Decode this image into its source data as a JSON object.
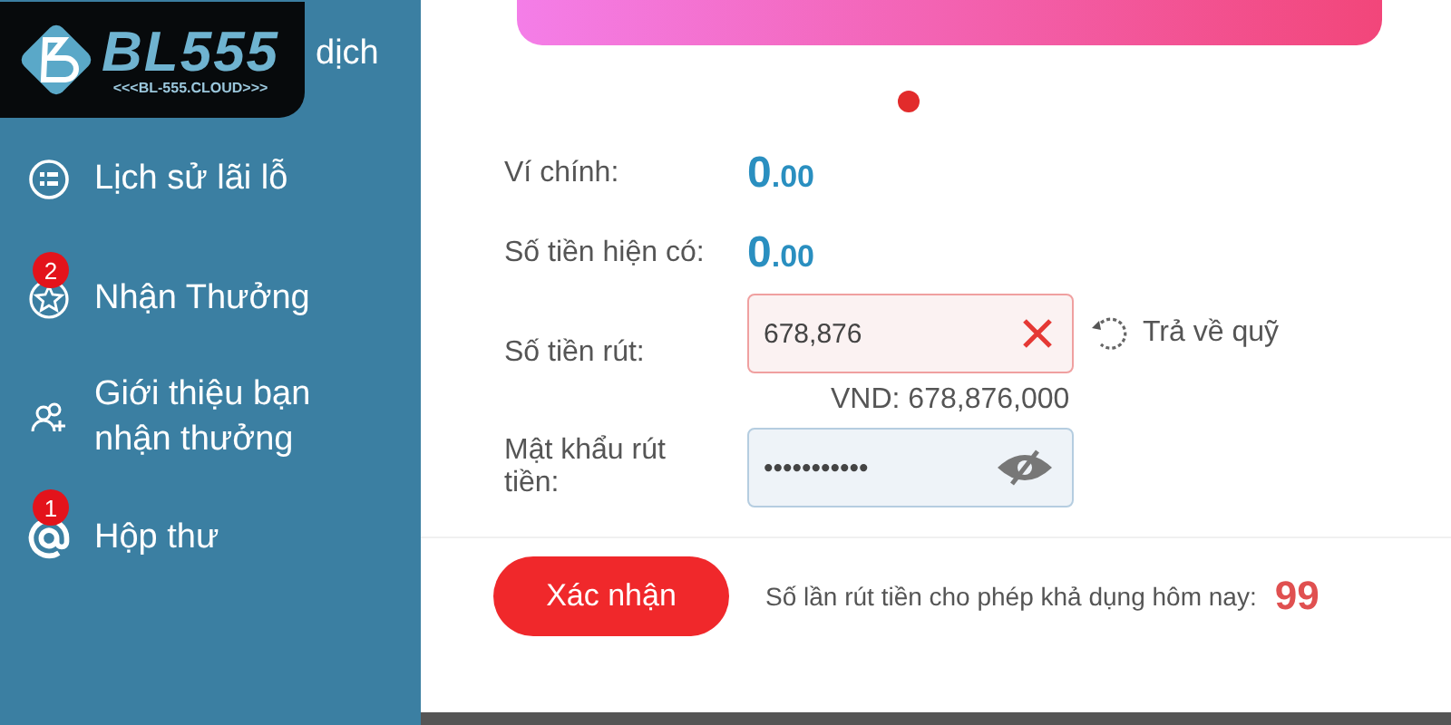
{
  "logo": {
    "name": "BL555",
    "tagline": "<<<BL-555.CLOUD>>>"
  },
  "sidebar": {
    "cut_item": "dịch",
    "items": [
      {
        "label": "Lịch sử lãi lỗ",
        "kind": "list"
      },
      {
        "label": "Nhận Thưởng",
        "kind": "star",
        "badge": "2"
      },
      {
        "label": "Giới thiệu bạn nhận thưởng",
        "kind": "people"
      },
      {
        "label": "Hộp thư",
        "kind": "mail",
        "badge": "1"
      }
    ]
  },
  "carousel": {
    "dots": [
      {
        "selected": true
      }
    ]
  },
  "form": {
    "balances": [
      {
        "label": "Ví chính:",
        "value": "0.00"
      },
      {
        "label": "Số tiền hiện có:",
        "value": "0.00"
      }
    ],
    "withdraw": {
      "label": "Số tiền rút:",
      "value": "678,876",
      "error": true,
      "reset_link": "Trả về quỹ",
      "converted": "VND: 678,876,000"
    },
    "password": {
      "label": "Mật khẩu rút tiền:",
      "value": "•••••••••••"
    },
    "submit": "Xác nhận",
    "limit_note": "Số lần rút tiền cho phép khả dụng hôm nay:",
    "limit_count": "99"
  }
}
